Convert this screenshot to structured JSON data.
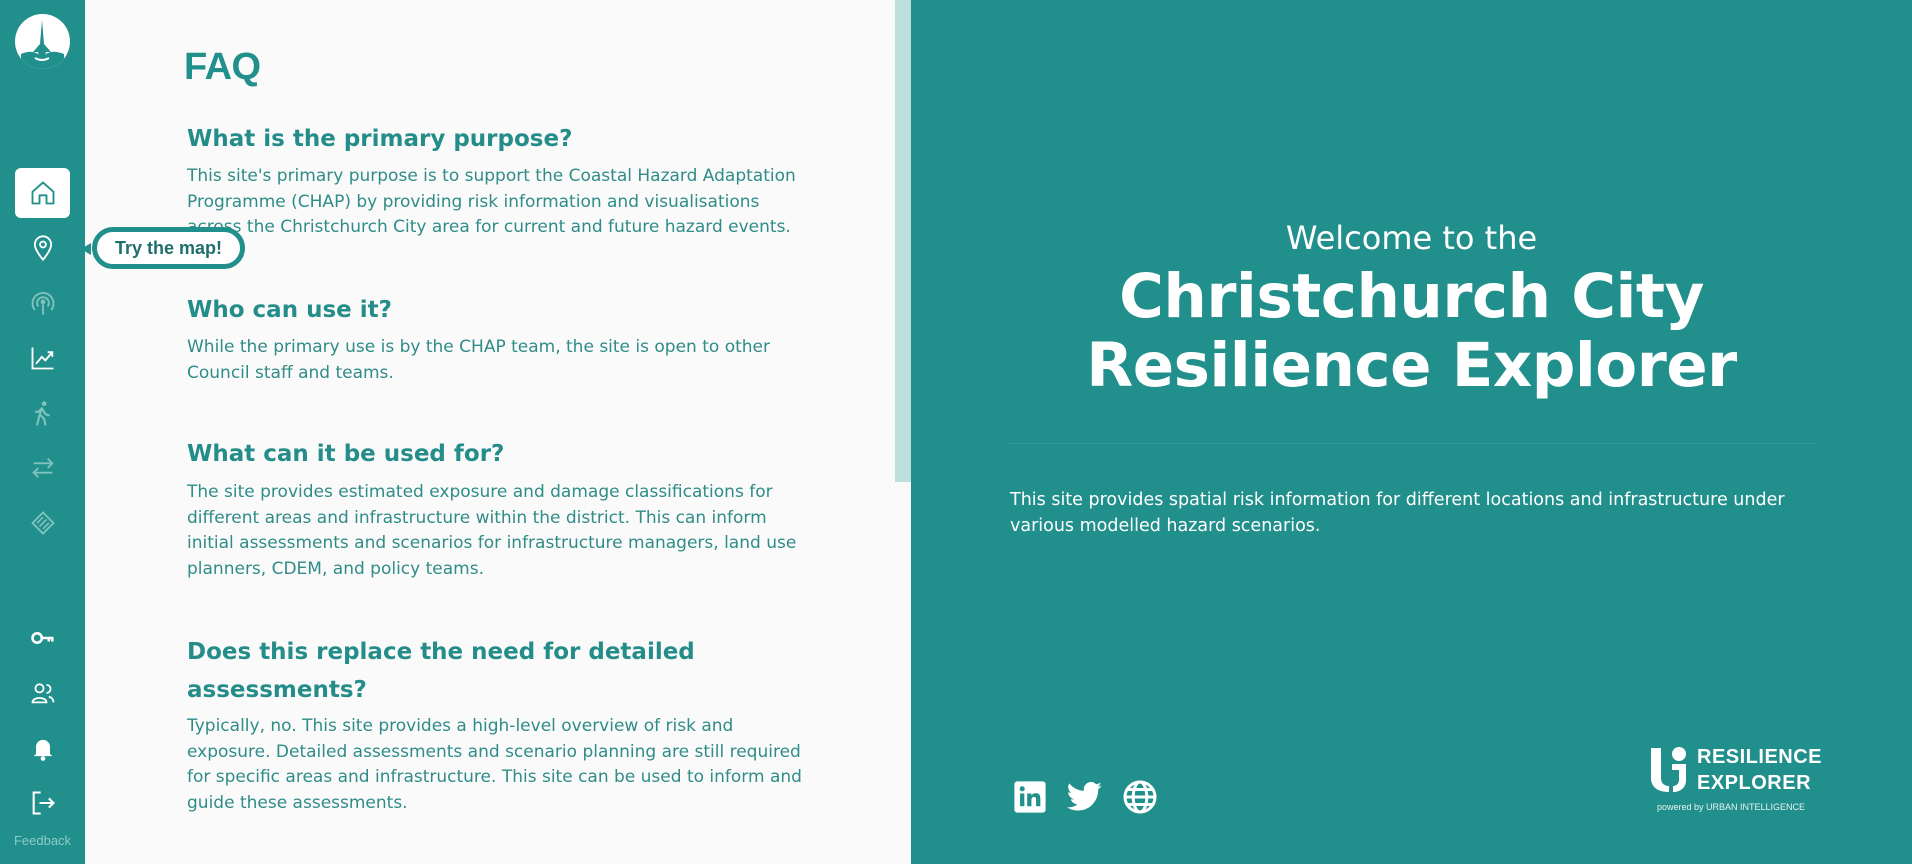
{
  "sidebar": {
    "items": [
      {
        "icon": "home-icon",
        "active": true
      },
      {
        "icon": "map-pin-icon"
      },
      {
        "icon": "broadcast-icon"
      },
      {
        "icon": "chart-line-icon"
      },
      {
        "icon": "walking-person-icon"
      },
      {
        "icon": "arrows-exchange-icon"
      },
      {
        "icon": "layers-icon"
      }
    ],
    "bottom_items": [
      {
        "icon": "key-icon"
      },
      {
        "icon": "users-icon"
      },
      {
        "icon": "bell-icon"
      },
      {
        "icon": "logout-icon"
      }
    ],
    "feedback_label": "Feedback"
  },
  "callout": {
    "label": "Try the map!"
  },
  "faq": {
    "title": "FAQ",
    "items": [
      {
        "question": "What is the primary purpose?",
        "answer": "This site's primary purpose is to support the Coastal Hazard Adaptation Programme (CHAP) by providing risk information and visualisations across the Christchurch City area for current and future hazard events."
      },
      {
        "question": "Who can use it?",
        "answer": "While the primary use is by the CHAP team, the site is open to other Council staff and teams."
      },
      {
        "question": "What can it be used for?",
        "answer": "The site provides estimated exposure and damage classifications for different areas and infrastructure within the district. This can inform initial assessments and scenarios for infrastructure managers, land use planners, CDEM, and policy teams."
      },
      {
        "question": "Does this replace the need for detailed assessments?",
        "answer": "Typically, no. This site provides a high-level overview of risk and exposure. Detailed assessments and scenario planning are still required for specific areas and infrastructure. This site can be used to inform and guide these assessments."
      }
    ]
  },
  "hero": {
    "welcome": "Welcome to the",
    "title_line1": "Christchurch City",
    "title_line2": "Resilience Explorer",
    "description": "This site provides spatial risk information for different locations and infrastructure under various modelled hazard scenarios.",
    "social": [
      {
        "icon": "linkedin-icon"
      },
      {
        "icon": "twitter-icon"
      },
      {
        "icon": "globe-icon"
      }
    ],
    "brand": {
      "line1": "RESILIENCE",
      "line2": "EXPLORER",
      "powered": "powered by URBAN INTELLIGENCE"
    }
  },
  "colors": {
    "teal": "#218f8b",
    "sidebar_icon_dim": "#7fc2be",
    "panel_bg": "#fafafa",
    "scrollbar": "#bde0de"
  }
}
